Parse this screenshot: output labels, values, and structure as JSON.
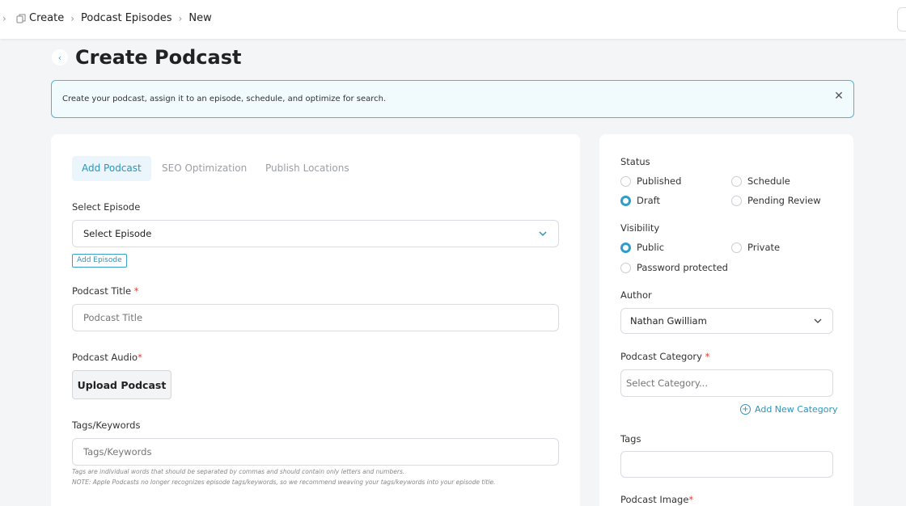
{
  "breadcrumb": {
    "items": [
      "Create",
      "Podcast Episodes",
      "New"
    ]
  },
  "page": {
    "title": "Create Podcast"
  },
  "banner": {
    "text": "Create your podcast, assign it to an episode, schedule, and optimize for search."
  },
  "tabs": [
    {
      "label": "Add Podcast",
      "active": true
    },
    {
      "label": "SEO Optimization",
      "active": false
    },
    {
      "label": "Publish Locations",
      "active": false
    }
  ],
  "form": {
    "episode_label": "Select Episode",
    "episode_value": "Select Episode",
    "add_episode_label": "Add Episode",
    "title_label": "Podcast Title",
    "title_placeholder": "Podcast Title",
    "audio_label": "Podcast Audio",
    "upload_label": "Upload Podcast",
    "tags_label": "Tags/Keywords",
    "tags_placeholder": "Tags/Keywords",
    "hint1": "Tags are individual words that should be separated by commas and should contain only letters and numbers.",
    "hint2": "NOTE: Apple Podcasts no longer recognizes episode tags/keywords, so we recommend weaving your tags/keywords into your episode title."
  },
  "sidebar": {
    "status_label": "Status",
    "status_options": [
      "Published",
      "Schedule",
      "Draft",
      "Pending Review"
    ],
    "status_selected": "Draft",
    "visibility_label": "Visibility",
    "visibility_options": [
      "Public",
      "Private",
      "Password protected"
    ],
    "visibility_selected": "Public",
    "author_label": "Author",
    "author_value": "Nathan Gwilliam",
    "category_label": "Podcast Category",
    "category_placeholder": "Select Category...",
    "add_category_label": "Add New Category",
    "tags_label": "Tags",
    "image_label": "Podcast Image"
  },
  "colors": {
    "accent": "#2b93bd",
    "required": "#e53935"
  }
}
